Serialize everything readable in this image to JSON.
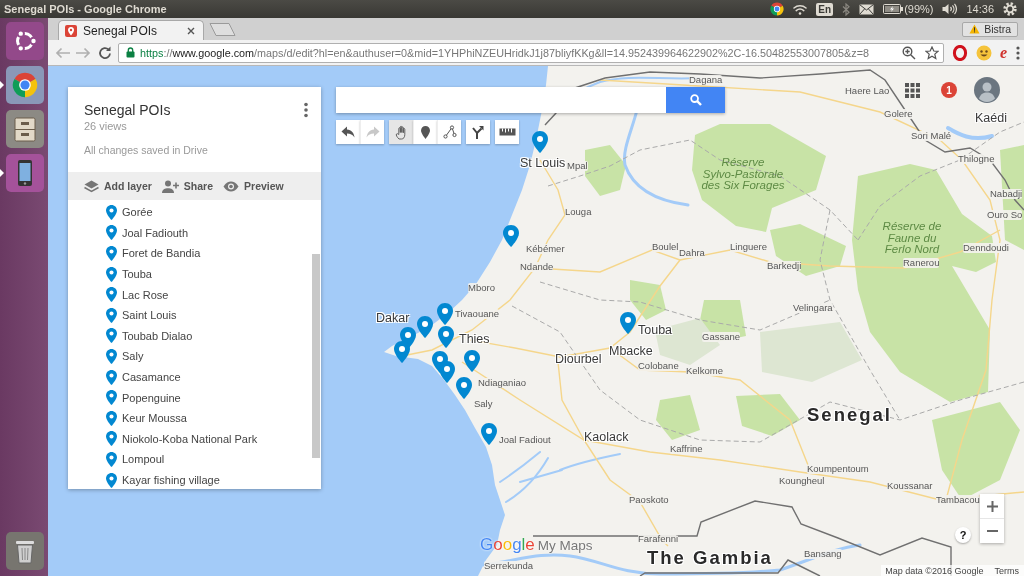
{
  "top_bar": {
    "window_title": "Senegal POIs - Google Chrome",
    "keyboard_layout": "En",
    "battery": "(99%)",
    "clock": "14:36"
  },
  "launcher": [
    {
      "kind": "home",
      "running": false
    },
    {
      "kind": "browser",
      "running": true
    },
    {
      "kind": "files",
      "running": false
    },
    {
      "kind": "phone",
      "running": true
    },
    {
      "kind": "trash",
      "running": false
    }
  ],
  "browser": {
    "tabs": [
      {
        "title": "Senegal POIs",
        "selected": true
      }
    ],
    "profile": "Bistra",
    "url": {
      "scheme": "https",
      "separator": "://",
      "host": "www.google.com",
      "path": "/maps/d/edit?hl=en&authuser=0&mid=1YHPhiNZEUHridkJ1j87bliyfKKg&ll=14.952439964622902%2C-16.50482553007805&z=8"
    },
    "extensions": [
      {
        "kind": "ring"
      },
      {
        "kind": "emoji"
      },
      {
        "kind": "letter",
        "glyph": "e"
      }
    ]
  },
  "map_panel": {
    "title": "Senegal POIs",
    "views": "26 views",
    "save_status": "All changes saved in Drive",
    "actions": [
      {
        "kind": "add_layer",
        "label": "Add layer"
      },
      {
        "kind": "share",
        "label": "Share"
      },
      {
        "kind": "preview",
        "label": "Preview"
      }
    ],
    "places": [
      "Gorée",
      "Joal Fadiouth",
      "Foret de Bandia",
      "Touba",
      "Lac Rose",
      "Saint Louis",
      "Toubab Dialao",
      "Saly",
      "Casamance",
      "Popenguine",
      "Keur Moussa",
      "Niokolo-Koba National Park",
      "Lompoul",
      "Kayar fishing village"
    ]
  },
  "tools": {
    "history": [
      {
        "kind": "undo",
        "disabled": false
      },
      {
        "kind": "redo",
        "disabled": true
      }
    ],
    "modes": [
      {
        "kind": "hand",
        "selected": true
      },
      {
        "kind": "marker",
        "selected": false
      },
      {
        "kind": "line",
        "selected": false
      }
    ],
    "extras": [
      {
        "kind": "route"
      },
      {
        "kind": "ruler"
      }
    ]
  },
  "account": {
    "notifications": "1"
  },
  "map": {
    "labels": [
      {
        "kind": "town",
        "text": "Dagana"
      },
      {
        "kind": "town",
        "text": "Haere Lao"
      },
      {
        "kind": "town",
        "text": "Golere"
      },
      {
        "kind": "city",
        "text": "Kaédi"
      },
      {
        "kind": "town",
        "text": "Sori Malé"
      },
      {
        "kind": "city",
        "text": "St Louis"
      },
      {
        "kind": "town",
        "text": "Mpal"
      },
      {
        "kind": "reserve",
        "text": "Réserve\nSylvo-Pastorale\ndes Six Forages"
      },
      {
        "kind": "town",
        "text": "Thilogne"
      },
      {
        "kind": "town",
        "text": "Nabadji"
      },
      {
        "kind": "town",
        "text": "Louga"
      },
      {
        "kind": "town",
        "text": "Ouro So"
      },
      {
        "kind": "town",
        "text": "Kébémer"
      },
      {
        "kind": "town",
        "text": "Boulel"
      },
      {
        "kind": "town",
        "text": "Dahra"
      },
      {
        "kind": "town",
        "text": "Linguere"
      },
      {
        "kind": "reserve",
        "text": "Réserve de\nFaune du\nFerlo Nord"
      },
      {
        "kind": "town",
        "text": "Denndoudi"
      },
      {
        "kind": "town",
        "text": "Ndande"
      },
      {
        "kind": "town",
        "text": "Barkedji"
      },
      {
        "kind": "town",
        "text": "Ranerou"
      },
      {
        "kind": "town",
        "text": "Mboro"
      },
      {
        "kind": "city",
        "text": "Dakar"
      },
      {
        "kind": "town",
        "text": "Tivaouane"
      },
      {
        "kind": "town",
        "text": "Velingara"
      },
      {
        "kind": "city",
        "text": "Thies"
      },
      {
        "kind": "city",
        "text": "Touba"
      },
      {
        "kind": "town",
        "text": "Gassane"
      },
      {
        "kind": "city",
        "text": "Diourbel"
      },
      {
        "kind": "city",
        "text": "Mbacke"
      },
      {
        "kind": "town",
        "text": "Colobane"
      },
      {
        "kind": "town",
        "text": "Kelkome"
      },
      {
        "kind": "town",
        "text": "Ndiaganiao"
      },
      {
        "kind": "town",
        "text": "Saly"
      },
      {
        "kind": "country",
        "text": "Senegal"
      },
      {
        "kind": "town",
        "text": "Joal Fadiout"
      },
      {
        "kind": "city",
        "text": "Kaolack"
      },
      {
        "kind": "town",
        "text": "Kaffrine"
      },
      {
        "kind": "town",
        "text": "Koumpentoum"
      },
      {
        "kind": "town",
        "text": "Koungheul"
      },
      {
        "kind": "town",
        "text": "Koussanar"
      },
      {
        "kind": "town",
        "text": "Paoskoto"
      },
      {
        "kind": "town",
        "text": "Tambacou"
      },
      {
        "kind": "town",
        "text": "Farafenni"
      },
      {
        "kind": "town",
        "text": "Serrekunda"
      },
      {
        "kind": "country",
        "text": "The Gambia"
      },
      {
        "kind": "town",
        "text": "Bansang"
      }
    ],
    "logo": {
      "brand": "Google",
      "product": "My Maps"
    },
    "help": "?",
    "attribution": "Map data ©2016 Google",
    "terms": "Terms"
  }
}
